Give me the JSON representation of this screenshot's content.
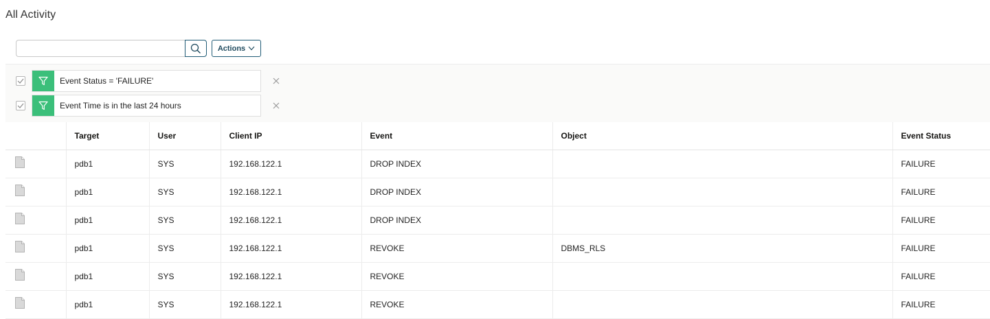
{
  "page": {
    "title": "All Activity"
  },
  "search": {
    "value": "",
    "placeholder": ""
  },
  "toolbar": {
    "actions_label": "Actions"
  },
  "filters": [
    {
      "label": "Event Status = 'FAILURE'",
      "checked": true
    },
    {
      "label": "Event Time is in the last 24 hours",
      "checked": true
    }
  ],
  "colors": {
    "filter_accent": "#3bbf7a",
    "button_border": "#1f5b75"
  },
  "table": {
    "columns": [
      "",
      "Target",
      "User",
      "Client IP",
      "Event",
      "Object",
      "Event Status"
    ],
    "rows": [
      {
        "target": "pdb1",
        "user": "SYS",
        "client_ip": "192.168.122.1",
        "event": "DROP INDEX",
        "object": "",
        "status": "FAILURE"
      },
      {
        "target": "pdb1",
        "user": "SYS",
        "client_ip": "192.168.122.1",
        "event": "DROP INDEX",
        "object": "",
        "status": "FAILURE"
      },
      {
        "target": "pdb1",
        "user": "SYS",
        "client_ip": "192.168.122.1",
        "event": "DROP INDEX",
        "object": "",
        "status": "FAILURE"
      },
      {
        "target": "pdb1",
        "user": "SYS",
        "client_ip": "192.168.122.1",
        "event": "REVOKE",
        "object": "DBMS_RLS",
        "status": "FAILURE"
      },
      {
        "target": "pdb1",
        "user": "SYS",
        "client_ip": "192.168.122.1",
        "event": "REVOKE",
        "object": "",
        "status": "FAILURE"
      },
      {
        "target": "pdb1",
        "user": "SYS",
        "client_ip": "192.168.122.1",
        "event": "REVOKE",
        "object": "",
        "status": "FAILURE"
      }
    ]
  }
}
